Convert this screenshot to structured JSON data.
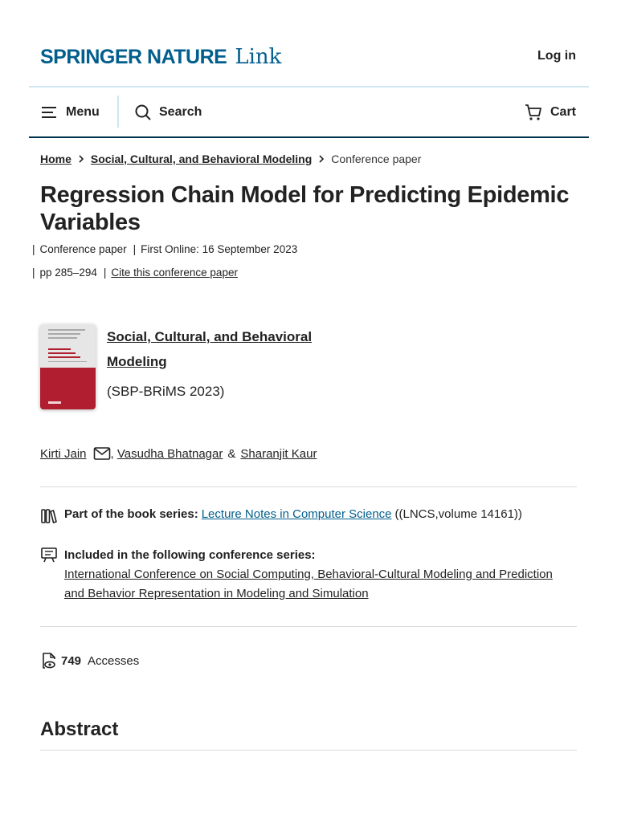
{
  "header": {
    "brand": "SPRINGER NATURE",
    "brand_link": "Link",
    "login_label": "Log in"
  },
  "navbar": {
    "menu_label": "Menu",
    "search_label": "Search",
    "cart_label": "Cart"
  },
  "breadcrumb": {
    "home": "Home",
    "section": "Social, Cultural, and Behavioral Modeling",
    "current": "Conference paper"
  },
  "article": {
    "title": "Regression Chain Model for Predicting Epidemic Variables",
    "type": "Conference paper",
    "first_online": "First Online: 16 September 2023",
    "pages": "pp 285–294",
    "cite_label": "Cite this conference paper"
  },
  "book": {
    "title": "Social, Cultural, and Behavioral Modeling",
    "subtitle": "(SBP-BRiMS 2023)"
  },
  "authors": {
    "first": "Kirti Jain",
    "second": "Vasudha Bhatnagar",
    "amp": "&",
    "third": "Sharanjit Kaur"
  },
  "series": {
    "label": "Part of the book series:",
    "link": "Lecture Notes in Computer Science",
    "suffix": "((LNCS,volume 14161))"
  },
  "conference": {
    "label": "Included in the following conference series:",
    "link": "International Conference on Social Computing, Behavioral-Cultural Modeling and Prediction and Behavior Representation in Modeling and Simulation"
  },
  "metrics": {
    "accesses_count": "749",
    "accesses_label": "Accesses"
  },
  "abstract": {
    "heading": "Abstract"
  },
  "colors": {
    "brand": "#025e8d",
    "nav_divider": "#01324b",
    "cover_red": "#b01e2f"
  },
  "icons": [
    "menu-icon",
    "search-icon",
    "cart-icon",
    "email-icon",
    "books-icon",
    "presentation-icon",
    "accesses-icon"
  ]
}
